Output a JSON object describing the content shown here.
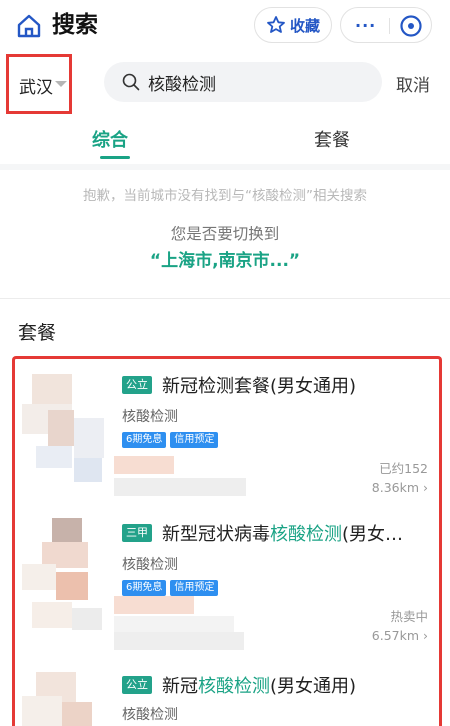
{
  "header": {
    "title": "搜索",
    "fav_label": "收藏",
    "more_label": "···"
  },
  "search": {
    "city": "武汉",
    "query": "核酸检测",
    "cancel": "取消"
  },
  "tabs": [
    {
      "label": "综合",
      "active": true
    },
    {
      "label": "套餐",
      "active": false
    }
  ],
  "notice": "抱歉，当前城市没有找到与“核酸检测”相关搜索",
  "switch_prompt": "您是否要切换到",
  "switch_cities": "“上海市,南京市...”",
  "section_title": "套餐",
  "items": [
    {
      "badge": "公立",
      "title_pre": "新冠检测套餐(男女通用)",
      "title_hl": "",
      "title_post": "",
      "subtitle": "核酸检测",
      "tags": [
        "6期免息",
        "信用预定"
      ],
      "status": "已约152",
      "distance": "8.36km",
      "thumb_label": "商品图片"
    },
    {
      "badge": "三甲",
      "title_pre": "新型冠状病毒",
      "title_hl": "核酸检测",
      "title_post": "(男女…",
      "subtitle": "核酸检测",
      "tags": [
        "6期免息",
        "信用预定"
      ],
      "status": "热卖中",
      "distance": "6.57km",
      "thumb_label": "商品图片"
    },
    {
      "badge": "公立",
      "title_pre": "新冠",
      "title_hl": "核酸检测",
      "title_post": "(男女通用)",
      "subtitle": "核酸检测",
      "tags": [],
      "status": "",
      "distance": "",
      "thumb_label": "商品图片"
    }
  ],
  "colors": {
    "accent": "#1aa385",
    "brand_blue": "#2457c5",
    "highlight_box": "#e53935",
    "tag_blue": "#2e8ff0"
  }
}
